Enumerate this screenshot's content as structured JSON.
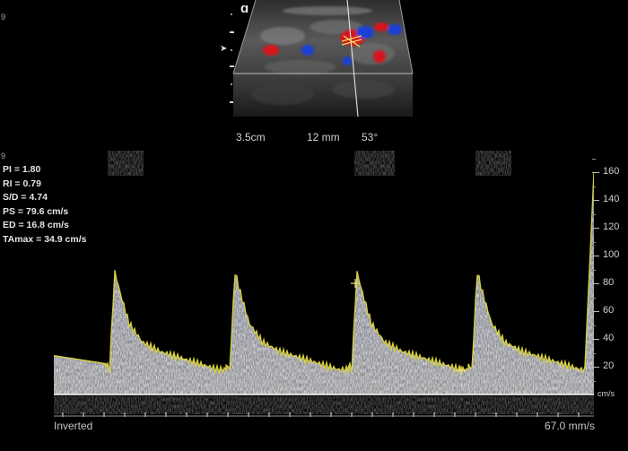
{
  "corner_marks": {
    "top": "9",
    "middle": "9"
  },
  "bmode": {
    "probe_icon": "probe-orientation-icon",
    "focus_icon": "focus-arrow-icon",
    "params": {
      "depth": "3.5cm",
      "gate": "12 mm",
      "angle": "53°"
    },
    "colors": {
      "flow_toward": "#d4191c",
      "flow_away": "#1c3fd6",
      "tissue": "#6f6f6f"
    }
  },
  "measurements": [
    "PI = 1.80",
    "RI = 0.79",
    "S/D = 4.74",
    "PS = 79.6 cm/s",
    "ED = 16.8 cm/s",
    "TAmax = 34.9 cm/s"
  ],
  "velocity_scale": {
    "labels": [
      "160",
      "140",
      "120",
      "100",
      "80",
      "60",
      "40",
      "20"
    ],
    "values": [
      160,
      140,
      120,
      100,
      80,
      60,
      40,
      20
    ],
    "unit": "cm/s",
    "range": [
      0,
      175
    ]
  },
  "footer": {
    "inverted": "Inverted",
    "sweep": "67.0 mm/s"
  },
  "colors": {
    "envelope": "#d8d23a",
    "baseline": "#ffffff",
    "spectrum": "#dcdff5"
  }
}
